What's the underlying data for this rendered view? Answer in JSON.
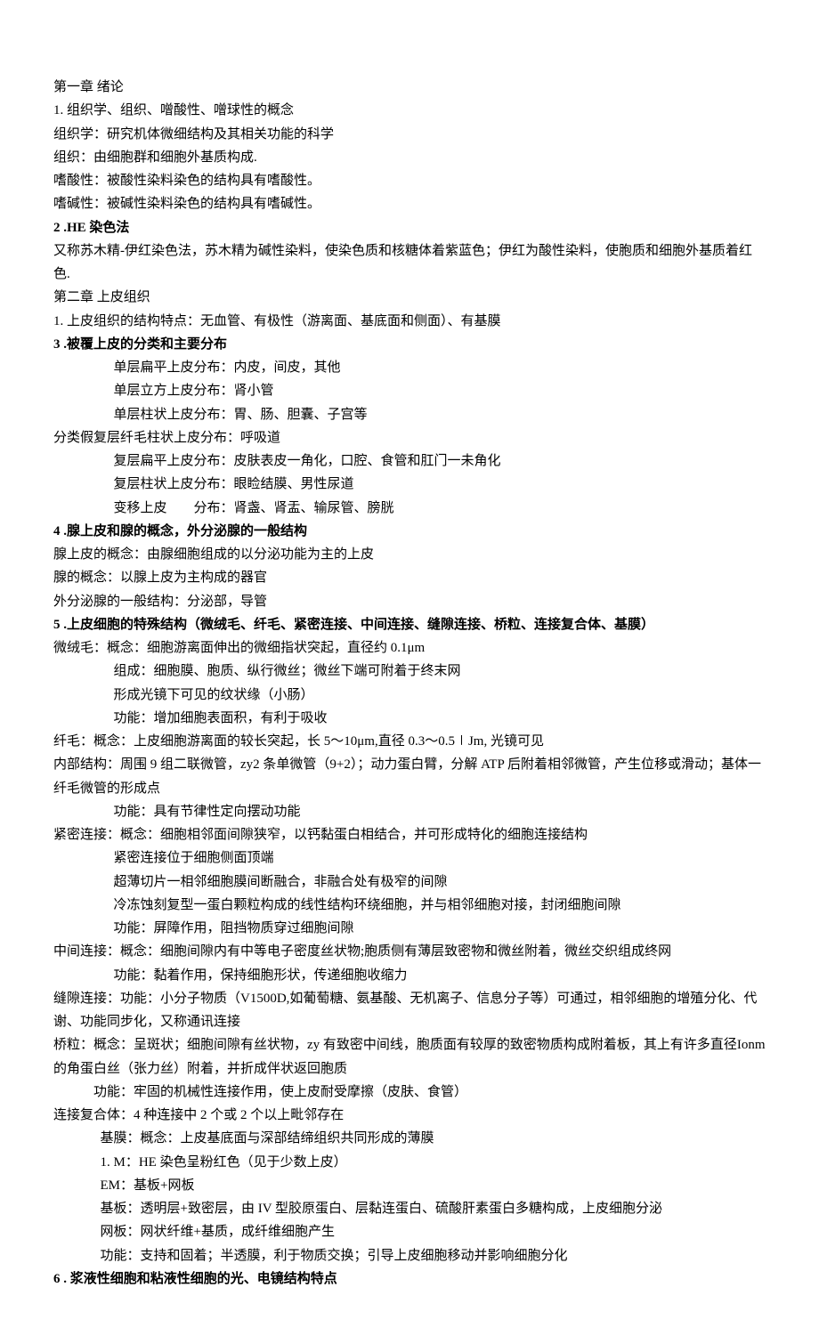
{
  "doc": {
    "chapter1_title": "第一章 绪论",
    "c1_l1": "1. 组织学、组织、噌酸性、噌球性的概念",
    "c1_l2": "组织学：研究机体微细结构及其相关功能的科学",
    "c1_l3": "组织：由细胞群和细胞外基质构成.",
    "c1_l4": "嗜酸性：被酸性染料染色的结构具有嗜酸性。",
    "c1_l5": "嗜碱性：被碱性染料染色的结构具有嗜碱性。",
    "c1_l6": "2  .HE 染色法",
    "c1_l7": "又称苏木精-伊红染色法，苏木精为碱性染料，使染色质和核糖体着紫蓝色；伊红为酸性染料，使胞质和细胞外基质着红色.",
    "chapter2_title": "第二章 上皮组织",
    "c2_l1": "1. 上皮组织的结构特点：无血管、有极性（游离面、基底面和侧面）、有基膜",
    "c2_l2": "3  .被覆上皮的分类和主要分布",
    "c2_l3": "单层扁平上皮分布：内皮，间皮，其他",
    "c2_l4": "单层立方上皮分布：肾小管",
    "c2_l5": "单层柱状上皮分布：胃、肠、胆囊、子宫等",
    "c2_l6": "分类假复层纤毛柱状上皮分布：呼吸道",
    "c2_l7": "复层扁平上皮分布：皮肤表皮一角化，口腔、食管和肛门一未角化",
    "c2_l8": "复层柱状上皮分布：眼睑结膜、男性尿道",
    "c2_l9": "变移上皮  分布：肾盏、肾盂、输尿管、膀胱",
    "c2_l10": "4  .腺上皮和腺的概念，外分泌腺的一般结构",
    "c2_l11": "腺上皮的概念：由腺细胞组成的以分泌功能为主的上皮",
    "c2_l12": "腺的概念：以腺上皮为主构成的器官",
    "c2_l13": "外分泌腺的一般结构：分泌部，导管",
    "c2_l14": "5  .上皮细胞的特殊结构（微绒毛、纤毛、紧密连接、中间连接、缝隙连接、桥粒、连接复合体、基膜）",
    "c2_l15": "微绒毛：概念：细胞游离面伸出的微细指状突起，直径约 0.1μm",
    "c2_l16": "组成：细胞膜、胞质、纵行微丝；微丝下端可附着于终末网",
    "c2_l17": "形成光镜下可见的纹状缘（小肠）",
    "c2_l18": "功能：增加细胞表面积，有利于吸收",
    "c2_l19": "纤毛：概念：上皮细胞游离面的较长突起，长 5～10μm,直径 0.3～0.5∣Jm, 光镜可见",
    "c2_l20": "内部结构：周围 9 组二联微管，zy2 条单微管（9+2）；动力蛋白臂，分解 ATP 后附着相邻微管，产生位移或滑动；基体一纤毛微管的形成点",
    "c2_l21": "功能：具有节律性定向摆动功能",
    "c2_l22": "紧密连接：概念：细胞相邻面间隙狭窄，以钙黏蛋白相结合，并可形成特化的细胞连接结构",
    "c2_l23": "紧密连接位于细胞侧面顶端",
    "c2_l24": "超薄切片一相邻细胞膜间断融合，非融合处有极窄的间隙",
    "c2_l25": "冷冻蚀刻复型一蛋白颗粒构成的线性结构环绕细胞，并与相邻细胞对接，封闭细胞间隙",
    "c2_l26": "功能：屏障作用，阻挡物质穿过细胞间隙",
    "c2_l27": "中间连接：概念：细胞间隙内有中等电子密度丝状物;胞质侧有薄层致密物和微丝附着，微丝交织组成终网",
    "c2_l28": "功能：黏着作用，保持细胞形状，传递细胞收缩力",
    "c2_l29": "缝隙连接：功能：小分子物质（V1500D,如葡萄糖、氨基酸、无机离子、信息分子等）可通过，相邻细胞的增殖分化、代谢、功能同步化，又称通讯连接",
    "c2_l30": "桥粒：概念：呈斑状；细胞间隙有丝状物，zy 有致密中间线，胞质面有较厚的致密物质构成附着板，其上有许多直径Ionm 的角蛋白丝（张力丝）附着，并折成伴状返回胞质",
    "c2_l31": "功能：牢固的机械性连接作用，使上皮耐受摩擦（皮肤、食管）",
    "c2_l32": "连接复合体：4 种连接中 2 个或 2 个以上毗邻存在",
    "c2_l33": "基膜：概念：上皮基底面与深部结缔组织共同形成的薄膜",
    "c2_l34": "1. M：HE 染色呈粉红色（见于少数上皮）",
    "c2_l35": "EM：基板+网板",
    "c2_l36": "基板：透明层+致密层，由 IV 型胶原蛋白、层黏连蛋白、硫酸肝素蛋白多糖构成，上皮细胞分泌",
    "c2_l37": "网板：网状纤维+基质，成纤维细胞产生",
    "c2_l38": "功能：支持和固着；半透膜，利于物质交换；引导上皮细胞移动并影响细胞分化",
    "c2_l39": "6  . 浆液性细胞和粘液性细胞的光、电镜结构特点"
  }
}
